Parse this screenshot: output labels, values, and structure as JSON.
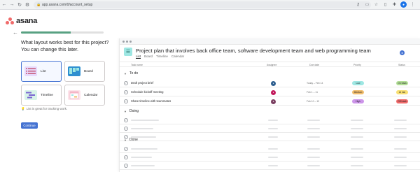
{
  "browser": {
    "url": "app.asana.com/0/account_setup",
    "nav_icons": [
      "back-icon",
      "forward-icon",
      "reload-icon",
      "tune-icon"
    ],
    "right_icons": [
      "key-icon",
      "cast-icon",
      "star-icon",
      "sidebar-icon",
      "extension-icon",
      "profile-icon",
      "menu-icon"
    ]
  },
  "brand": {
    "name": "asana",
    "color": "#f06a6a"
  },
  "setup": {
    "progress": 0.6,
    "question": "What layout works best for this project? You can change this later.",
    "options": [
      {
        "label": "List",
        "selected": true,
        "thumb_color": "#e7d9fb",
        "icon": "list-icon"
      },
      {
        "label": "Board",
        "selected": false,
        "thumb_color": "#2f8fd0",
        "icon": "board-icon"
      },
      {
        "label": "Timeline",
        "selected": false,
        "thumb_color": "#d8f4e9",
        "icon": "timeline-icon"
      },
      {
        "label": "Calendar",
        "selected": false,
        "thumb_color": "#fde3ea",
        "icon": "calendar-icon"
      }
    ],
    "hint": "List is great for tracking work.",
    "continue_label": "Continue",
    "accent": "#4573d2"
  },
  "preview": {
    "project_title": "Project plan that involves back office team, software development team and web programming team",
    "tabs": [
      "List",
      "Board",
      "Timeline",
      "Calendar"
    ],
    "active_tab": "List",
    "columns": {
      "task": "Task name",
      "assignee": "Assignee",
      "due": "Due date",
      "priority": "Priority",
      "status": "Status"
    },
    "sections": [
      {
        "name": "To do",
        "tasks": [
          {
            "name": "Draft project brief",
            "assignee_color": "#2d5e8f",
            "due": "Today – Feb 14",
            "priority": "Low",
            "priority_color": "#9ee7e3",
            "status": "On track",
            "status_color": "#b3df97"
          },
          {
            "name": "Schedule kickoff meeting",
            "assignee_color": "#c2185b",
            "due": "Feb 1 – 11",
            "priority": "Medium",
            "priority_color": "#f1bd6c",
            "status": "At risk",
            "status_color": "#f8df72"
          },
          {
            "name": "Share timeline with teammates",
            "assignee_color": "#7b3f61",
            "due": "Feb 10 – 12",
            "priority": "High",
            "priority_color": "#cd95ea",
            "status": "Off track",
            "status_color": "#f06a6a"
          }
        ]
      },
      {
        "name": "Doing",
        "tasks": []
      },
      {
        "name": "Done",
        "tasks": []
      }
    ]
  }
}
